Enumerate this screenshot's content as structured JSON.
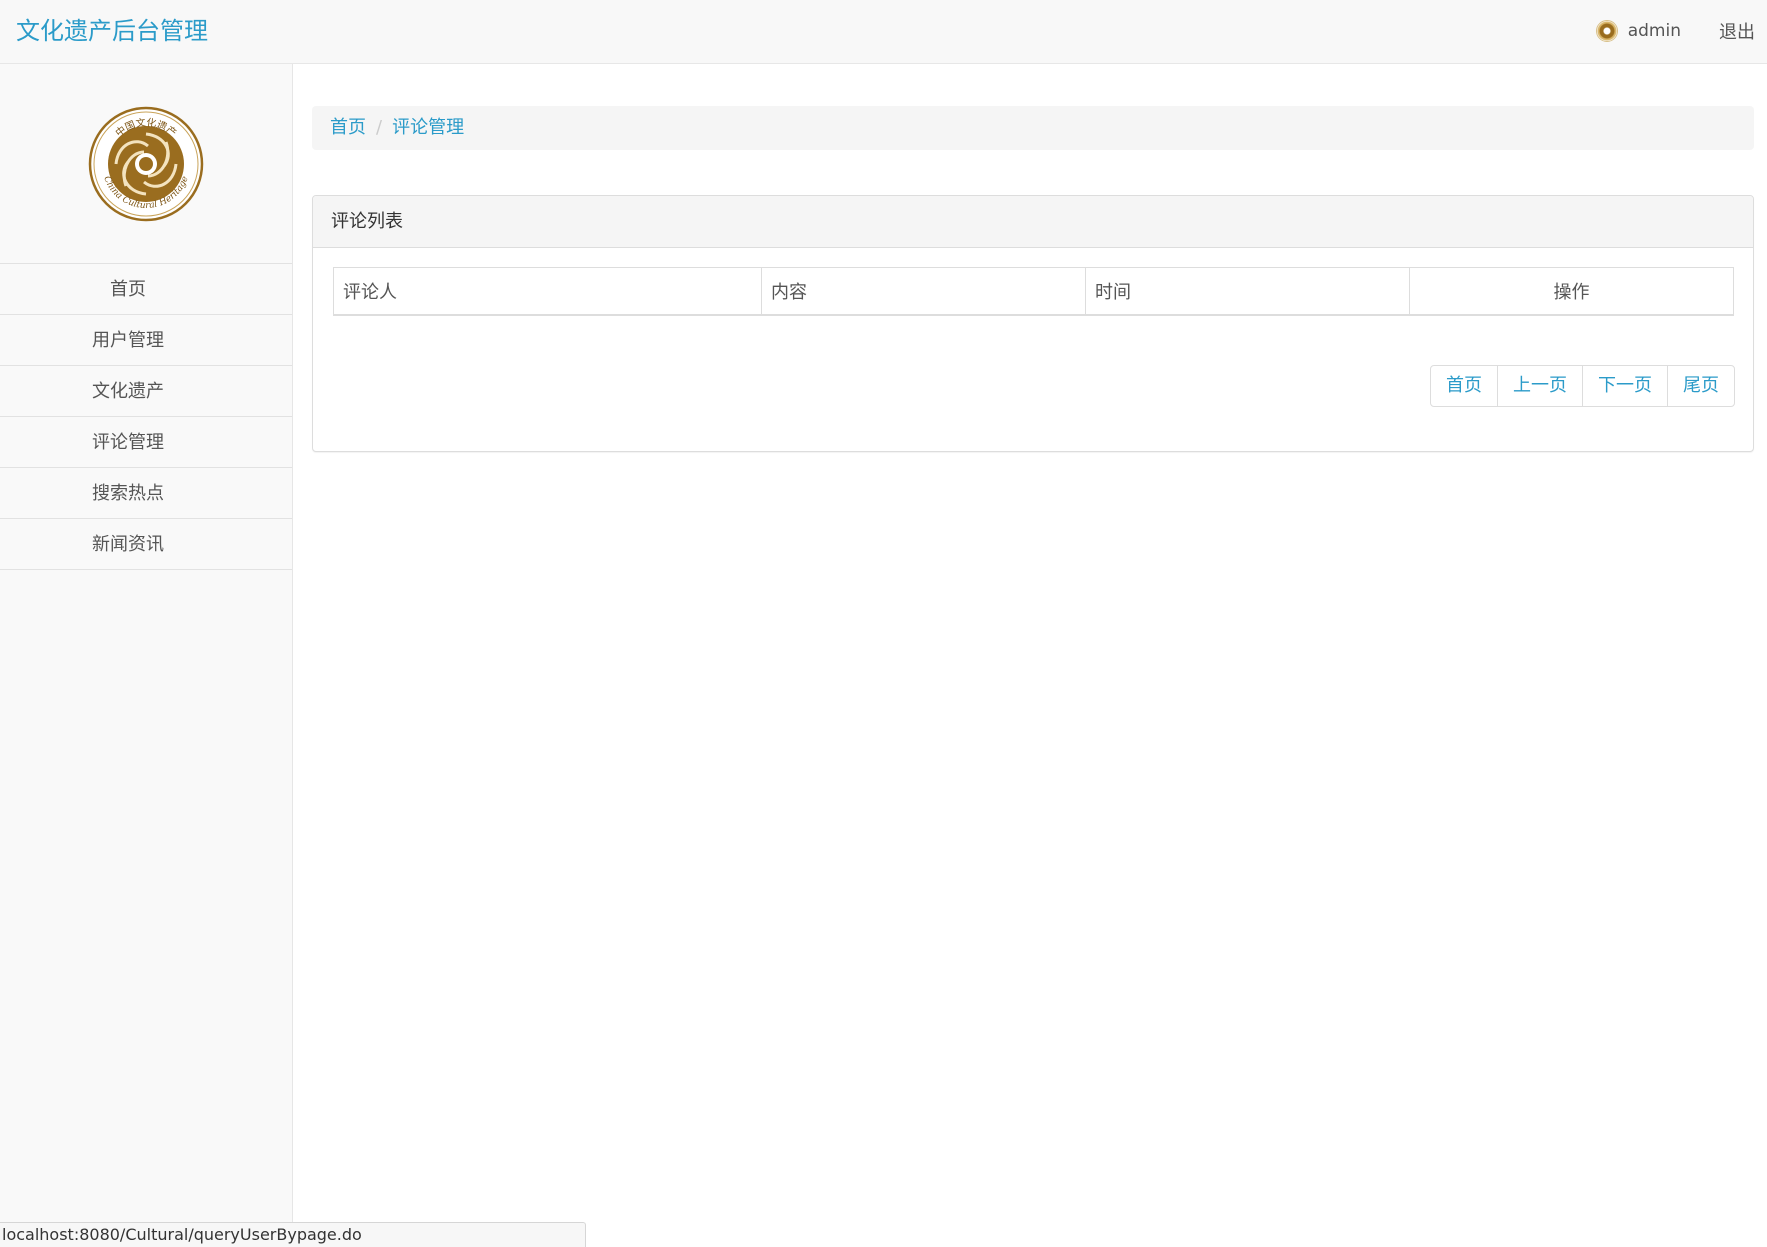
{
  "navbar": {
    "brand": "文化遗产后台管理",
    "user": "admin",
    "logout": "退出"
  },
  "sidebar": {
    "logo_text_top": "中国文化遗产",
    "logo_text_bottom": "China Cultural Heritage",
    "items": [
      {
        "label": "首页"
      },
      {
        "label": "用户管理"
      },
      {
        "label": "文化遗产"
      },
      {
        "label": "评论管理"
      },
      {
        "label": "搜索热点"
      },
      {
        "label": "新闻资讯"
      }
    ]
  },
  "breadcrumb": {
    "home": "首页",
    "separator": "/",
    "current": "评论管理"
  },
  "panel": {
    "title": "评论列表",
    "columns": [
      "评论人",
      "内容",
      "时间",
      "操作"
    ]
  },
  "pagination": {
    "first": "首页",
    "prev": "上一页",
    "next": "下一页",
    "last": "尾页"
  },
  "statusbar": {
    "url": "localhost:8080/Cultural/queryUserBypage.do"
  },
  "colors": {
    "accent": "#2b9bc9",
    "logo_gold": "#9a6d1f"
  }
}
